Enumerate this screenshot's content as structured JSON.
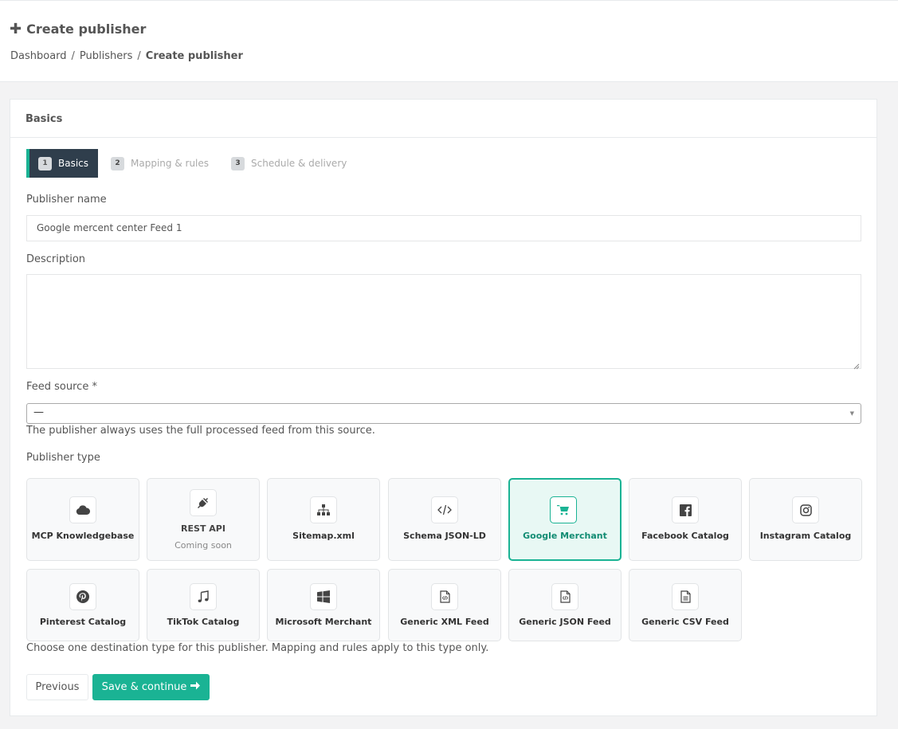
{
  "header": {
    "title": "Create publisher",
    "breadcrumb": [
      "Dashboard",
      "Publishers",
      "Create publisher"
    ]
  },
  "panel": {
    "title": "Basics",
    "steps": [
      {
        "num": "1",
        "label": "Basics"
      },
      {
        "num": "2",
        "label": "Mapping & rules"
      },
      {
        "num": "3",
        "label": "Schedule & delivery"
      }
    ]
  },
  "form": {
    "name_label": "Publisher name",
    "name_value": "Google mercent center Feed 1",
    "description_label": "Description",
    "description_value": "",
    "source_label": "Feed source *",
    "source_value": "—",
    "source_help": "The publisher always uses the full processed feed from this source.",
    "type_label": "Publisher type",
    "type_help": "Choose one destination type for this publisher. Mapping and rules apply to this type only."
  },
  "types": [
    {
      "name": "MCP Knowledgebase",
      "icon": "cloud-icon"
    },
    {
      "name": "REST API",
      "sub": "Coming soon",
      "icon": "plug-icon"
    },
    {
      "name": "Sitemap.xml",
      "icon": "sitemap-icon"
    },
    {
      "name": "Schema JSON-LD",
      "icon": "code-icon"
    },
    {
      "name": "Google Merchant",
      "icon": "cart-icon",
      "selected": true
    },
    {
      "name": "Facebook Catalog",
      "icon": "facebook-icon"
    },
    {
      "name": "Instagram Catalog",
      "icon": "instagram-icon"
    },
    {
      "name": "Pinterest Catalog",
      "icon": "pinterest-icon"
    },
    {
      "name": "TikTok Catalog",
      "icon": "music-icon"
    },
    {
      "name": "Microsoft Merchant",
      "icon": "windows-icon"
    },
    {
      "name": "Generic XML Feed",
      "icon": "file-code-icon"
    },
    {
      "name": "Generic JSON Feed",
      "icon": "file-code-icon"
    },
    {
      "name": "Generic CSV Feed",
      "icon": "file-text-icon"
    }
  ],
  "buttons": {
    "previous": "Previous",
    "save": "Save & continue"
  },
  "colors": {
    "accent": "#1ab394",
    "step_active_bg": "#2f3e4c"
  }
}
